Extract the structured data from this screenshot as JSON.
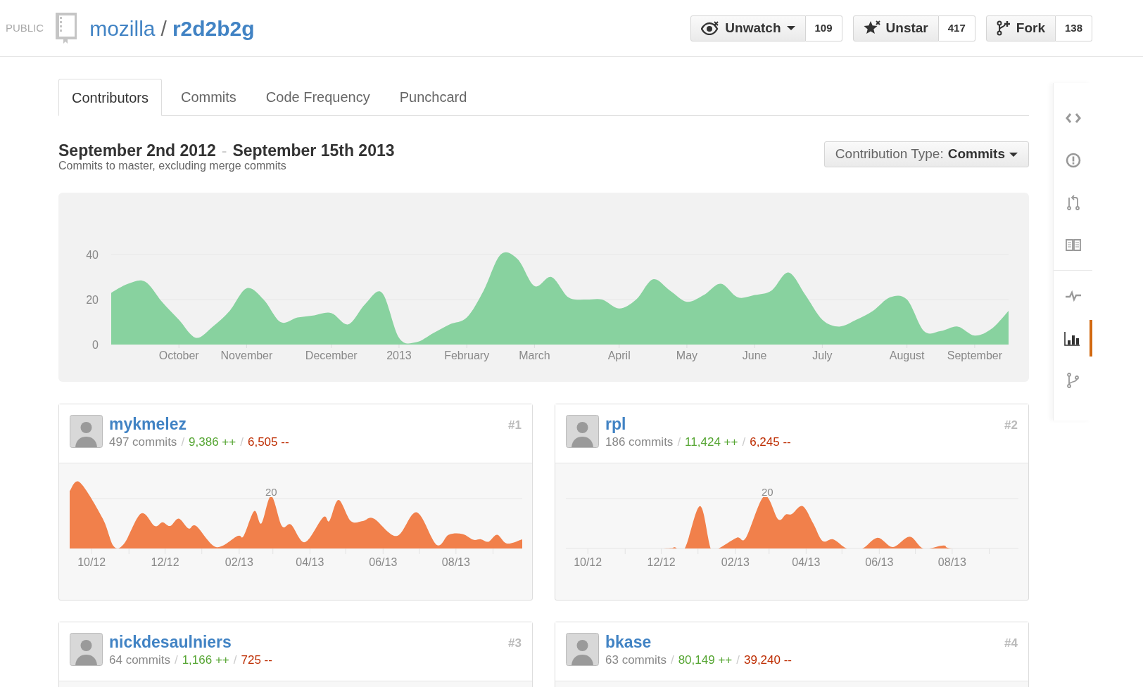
{
  "repo": {
    "visibility": "PUBLIC",
    "owner": "mozilla",
    "separator": "/",
    "name": "r2d2b2g"
  },
  "actions": [
    {
      "kind": "watch",
      "label": "Unwatch",
      "count": "109",
      "dropdown": true
    },
    {
      "kind": "star",
      "label": "Unstar",
      "count": "417",
      "dropdown": false
    },
    {
      "kind": "fork",
      "label": "Fork",
      "count": "138",
      "dropdown": false
    }
  ],
  "tabs": [
    {
      "label": "Contributors",
      "selected": true
    },
    {
      "label": "Commits",
      "selected": false
    },
    {
      "label": "Code Frequency",
      "selected": false
    },
    {
      "label": "Punchcard",
      "selected": false
    }
  ],
  "range": {
    "start": "September 2nd 2012",
    "separator": "-",
    "end": "September 15th 2013",
    "subtitle": "Commits to master, excluding merge commits"
  },
  "contribution_type": {
    "label": "Contribution Type:",
    "value": "Commits"
  },
  "chart_data": {
    "type": "area",
    "ylim": [
      0,
      40
    ],
    "yticks": [
      0,
      20,
      40
    ],
    "categories": [
      null,
      null,
      null,
      null,
      "October",
      null,
      null,
      null,
      "November",
      null,
      null,
      null,
      null,
      "December",
      null,
      null,
      null,
      "2013",
      null,
      null,
      null,
      "February",
      null,
      null,
      null,
      "March",
      null,
      null,
      null,
      null,
      "April",
      null,
      null,
      null,
      "May",
      null,
      null,
      null,
      "June",
      null,
      null,
      null,
      "July",
      null,
      null,
      null,
      null,
      "August",
      null,
      null,
      null,
      "September",
      null,
      null
    ],
    "series": [
      {
        "color": "#88d29f",
        "values": [
          23,
          27,
          28,
          19,
          11,
          3,
          8,
          15,
          25,
          20,
          10,
          12,
          13,
          14,
          9,
          18,
          23,
          3,
          1,
          5,
          9,
          12,
          24,
          40,
          38,
          26,
          30,
          21,
          20,
          20,
          16,
          20,
          29,
          24,
          19,
          22,
          27,
          21,
          22,
          24,
          32,
          22,
          11,
          8,
          11,
          15,
          21,
          20,
          6,
          6,
          8,
          4,
          7,
          15
        ]
      }
    ]
  },
  "contributors": [
    {
      "name": "mykmelez",
      "rank": "#1",
      "stats": [
        {
          "kind": "commits",
          "text": "497 commits"
        },
        {
          "kind": "separator",
          "text": "/"
        },
        {
          "kind": "additions",
          "text": "9,386 ++"
        },
        {
          "kind": "separator",
          "text": "/"
        },
        {
          "kind": "deletions",
          "text": "6,505 --"
        }
      ],
      "y_label": "20",
      "x_labels": [
        "10/12",
        "12/12",
        "02/13",
        "04/13",
        "06/13",
        "08/13"
      ]
    },
    {
      "name": "rpl",
      "rank": "#2",
      "stats": [
        {
          "kind": "commits",
          "text": "186 commits"
        },
        {
          "kind": "separator",
          "text": "/"
        },
        {
          "kind": "additions",
          "text": "11,424 ++"
        },
        {
          "kind": "separator",
          "text": "/"
        },
        {
          "kind": "deletions",
          "text": "6,245 --"
        }
      ],
      "y_label": "20",
      "x_labels": [
        "10/12",
        "12/12",
        "02/13",
        "04/13",
        "06/13",
        "08/13"
      ]
    },
    {
      "name": "nickdesaulniers",
      "rank": "#3",
      "stats": [
        {
          "kind": "commits",
          "text": "64 commits"
        },
        {
          "kind": "separator",
          "text": "/"
        },
        {
          "kind": "additions",
          "text": "1,166 ++"
        },
        {
          "kind": "separator",
          "text": "/"
        },
        {
          "kind": "deletions",
          "text": "725 --"
        }
      ]
    },
    {
      "name": "bkase",
      "rank": "#4",
      "stats": [
        {
          "kind": "commits",
          "text": "63 commits"
        },
        {
          "kind": "separator",
          "text": "/"
        },
        {
          "kind": "additions",
          "text": "80,149 ++"
        },
        {
          "kind": "separator",
          "text": "/"
        },
        {
          "kind": "deletions",
          "text": "39,240 --"
        }
      ]
    }
  ],
  "sidebar": [
    {
      "kind": "code",
      "selected": false
    },
    {
      "kind": "issues",
      "selected": false
    },
    {
      "kind": "pulls",
      "selected": false
    },
    {
      "kind": "wiki",
      "selected": false
    },
    {
      "kind": "pulse",
      "selected": false
    },
    {
      "kind": "graphs",
      "selected": true
    },
    {
      "kind": "network",
      "selected": false
    }
  ]
}
